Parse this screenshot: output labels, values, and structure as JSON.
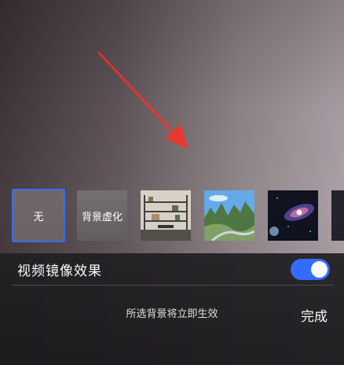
{
  "backgrounds": {
    "none_label": "无",
    "blur_label": "背景虚化",
    "items": [
      "office-image",
      "landscape-image",
      "galaxy-image"
    ]
  },
  "mirror": {
    "label": "视频镜像效果",
    "enabled": true
  },
  "footer": {
    "hint": "所选背景将立即生效",
    "done_label": "完成"
  },
  "colors": {
    "accent": "#2f6bff",
    "annotation_arrow": "#e8372f",
    "panel_bg": "#1c1b1e"
  }
}
